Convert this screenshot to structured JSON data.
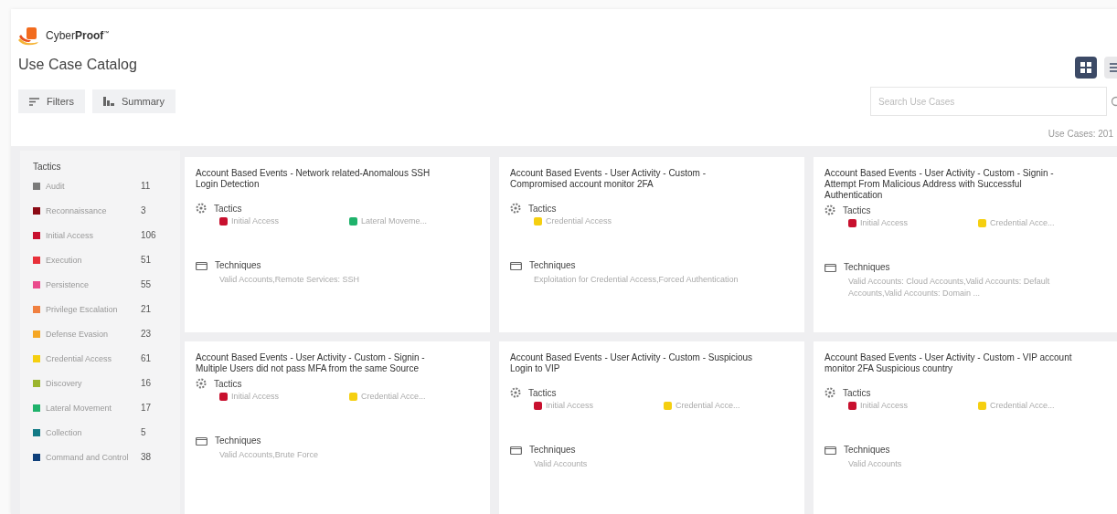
{
  "brand": {
    "name_light": "Cyber",
    "name_bold": "Proof",
    "mark": "™"
  },
  "page_title": "Use Case Catalog",
  "toolbar": [
    {
      "label": "Filters",
      "kind": "filter"
    },
    {
      "label": "Summary",
      "kind": "summary"
    }
  ],
  "view_toggle": [
    {
      "kind": "grid",
      "selected": true
    },
    {
      "kind": "list",
      "selected": false
    }
  ],
  "search": {
    "placeholder": "Search Use Cases"
  },
  "result_count": "Use Cases: 201",
  "sidebar": {
    "title": "Tactics",
    "items": [
      {
        "label": "Audit",
        "count": "11",
        "color": "#7a7a7a"
      },
      {
        "label": "Reconnaissance",
        "count": "3",
        "color": "#8b0a14"
      },
      {
        "label": "Initial Access",
        "count": "106",
        "color": "#c8102e"
      },
      {
        "label": "Execution",
        "count": "51",
        "color": "#e8303a"
      },
      {
        "label": "Persistence",
        "count": "55",
        "color": "#ea4b8c"
      },
      {
        "label": "Privilege Escalation",
        "count": "21",
        "color": "#f08040"
      },
      {
        "label": "Defense Evasion",
        "count": "23",
        "color": "#f5a623"
      },
      {
        "label": "Credential Access",
        "count": "61",
        "color": "#f5cf10"
      },
      {
        "label": "Discovery",
        "count": "16",
        "color": "#9bb52e"
      },
      {
        "label": "Lateral Movement",
        "count": "17",
        "color": "#1fb26b"
      },
      {
        "label": "Collection",
        "count": "5",
        "color": "#137a86"
      },
      {
        "label": "Command and Control",
        "count": "38",
        "color": "#0e3f7a"
      }
    ]
  },
  "cards": [
    {
      "title": "Account Based Events - Network related-Anomalous SSH Login Detection",
      "tactics_label": "Tactics",
      "tactics": [
        {
          "label": "Initial Access",
          "color": "#c8102e"
        },
        {
          "label": "Lateral Moveme...",
          "color": "#1fb26b"
        }
      ],
      "techniques_label": "Techniques",
      "techniques": "Valid Accounts,Remote Services: SSH"
    },
    {
      "title": "Account Based Events - User Activity - Custom - Compromised account monitor 2FA",
      "tactics_label": "Tactics",
      "tactics": [
        {
          "label": "Credential Access",
          "color": "#f5cf10"
        }
      ],
      "techniques_label": "Techniques",
      "techniques": "Exploitation for Credential Access,Forced Authentication"
    },
    {
      "title": "Account Based Events - User Activity - Custom - Signin - Attempt From Malicious Address with Successful Authentication",
      "tactics_label": "Tactics",
      "tactics": [
        {
          "label": "Initial Access",
          "color": "#c8102e"
        },
        {
          "label": "Credential Acce...",
          "color": "#f5cf10"
        }
      ],
      "techniques_label": "Techniques",
      "techniques": "Valid Accounts: Cloud Accounts,Valid Accounts: Default Accounts,Valid Accounts: Domain ..."
    },
    {
      "title": "Account Based Events - User Activity - Custom - Signin - Multiple Users did not pass MFA from the same Source",
      "tactics_label": "Tactics",
      "tactics": [
        {
          "label": "Initial Access",
          "color": "#c8102e"
        },
        {
          "label": "Credential Acce...",
          "color": "#f5cf10"
        }
      ],
      "techniques_label": "Techniques",
      "techniques": "Valid Accounts,Brute Force"
    },
    {
      "title": "Account Based Events - User Activity - Custom - Suspicious Login to VIP",
      "tactics_label": "Tactics",
      "tactics": [
        {
          "label": "Initial Access",
          "color": "#c8102e"
        },
        {
          "label": "Credential Acce...",
          "color": "#f5cf10"
        }
      ],
      "techniques_label": "Techniques",
      "techniques": "Valid Accounts"
    },
    {
      "title": "Account Based Events - User Activity - Custom - VIP account monitor 2FA Suspicious country",
      "tactics_label": "Tactics",
      "tactics": [
        {
          "label": "Initial Access",
          "color": "#c8102e"
        },
        {
          "label": "Credential Acce...",
          "color": "#f5cf10"
        }
      ],
      "techniques_label": "Techniques",
      "techniques": "Valid Accounts"
    }
  ]
}
